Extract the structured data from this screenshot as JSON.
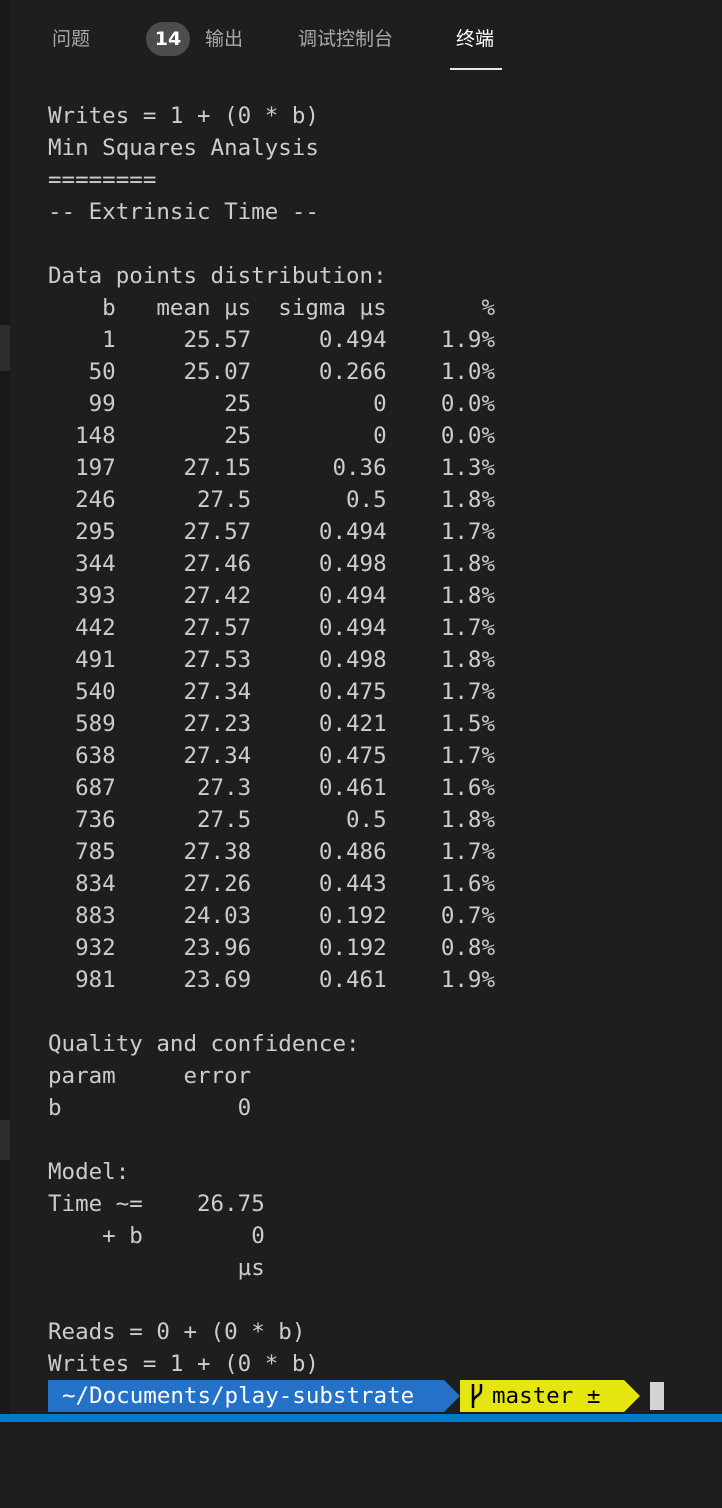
{
  "panel": {
    "tabs": [
      {
        "label": "问题",
        "active": false
      },
      {
        "label": "输出",
        "active": false
      },
      {
        "label": "调试控制台",
        "active": false
      },
      {
        "label": "终端",
        "active": true
      }
    ],
    "problems_badge": "14"
  },
  "terminal": {
    "lines": [
      "Writes = 1 + (0 * b)",
      "Min Squares Analysis",
      "========",
      "-- Extrinsic Time --",
      "",
      "Data points distribution:",
      "    b   mean µs  sigma µs       %",
      "    1     25.57     0.494    1.9%",
      "   50     25.07     0.266    1.0%",
      "   99        25         0    0.0%",
      "  148        25         0    0.0%",
      "  197     27.15      0.36    1.3%",
      "  246      27.5       0.5    1.8%",
      "  295     27.57     0.494    1.7%",
      "  344     27.46     0.498    1.8%",
      "  393     27.42     0.494    1.8%",
      "  442     27.57     0.494    1.7%",
      "  491     27.53     0.498    1.8%",
      "  540     27.34     0.475    1.7%",
      "  589     27.23     0.421    1.5%",
      "  638     27.34     0.475    1.7%",
      "  687      27.3     0.461    1.6%",
      "  736      27.5       0.5    1.8%",
      "  785     27.38     0.486    1.7%",
      "  834     27.26     0.443    1.6%",
      "  883     24.03     0.192    0.7%",
      "  932     23.96     0.192    0.8%",
      "  981     23.69     0.461    1.9%",
      "",
      "Quality and confidence:",
      "param     error",
      "b             0",
      "",
      "Model:",
      "Time ~=    26.75",
      "    + b        0",
      "              µs",
      "",
      "Reads = 0 + (0 * b)",
      "Writes = 1 + (0 * b)"
    ],
    "prompt": {
      "path": "~/Documents/play-substrate",
      "branch_icon": "git-branch-icon",
      "branch": "master ±"
    }
  },
  "colors": {
    "background": "#1e1e1e",
    "text": "#cccccc",
    "prompt_path_bg": "#2472c8",
    "prompt_git_bg": "#e5e510",
    "status_bar": "#007acc"
  }
}
